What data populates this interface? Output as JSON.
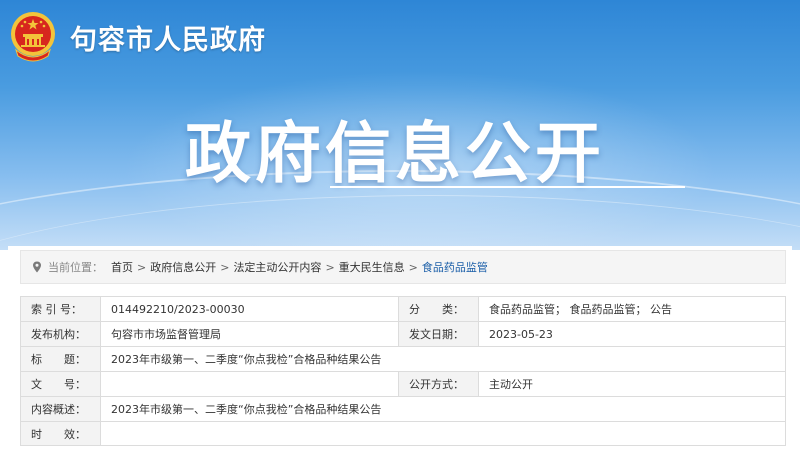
{
  "header": {
    "site_title": "句容市人民政府",
    "banner_title": "政府信息公开"
  },
  "breadcrumb": {
    "label": "当前位置：",
    "items": [
      "首页",
      "政府信息公开",
      "法定主动公开内容",
      "重大民生信息",
      "食品药品监管"
    ],
    "separator": ">"
  },
  "info": {
    "index_label": "索 引 号：",
    "index_value": "014492210/2023-00030",
    "category_label": "分　　类：",
    "category_value": "食品药品监管； 食品药品监管； 公告",
    "publisher_label": "发布机构：",
    "publisher_value": "句容市市场监督管理局",
    "date_label": "发文日期：",
    "date_value": "2023-05-23",
    "title_label": "标　　题：",
    "title_value": "2023年市级第一、二季度“你点我检”合格品种结果公告",
    "docno_label": "文　　号：",
    "docno_value": "",
    "method_label": "公开方式：",
    "method_value": "主动公开",
    "summary_label": "内容概述：",
    "summary_value": "2023年市级第一、二季度“你点我检”合格品种结果公告",
    "validity_label": "时　　效：",
    "validity_value": ""
  },
  "colors": {
    "banner_top": "#2e86d6",
    "banner_bottom": "#c4def7",
    "emblem_red": "#d7261e",
    "emblem_gold": "#f3c43a",
    "link_blue": "#1a5ea8"
  }
}
